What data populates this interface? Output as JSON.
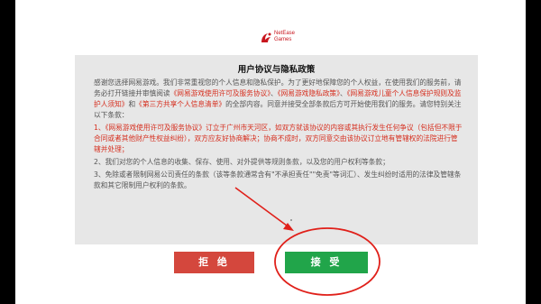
{
  "brand": {
    "logo_line1": "NetEase",
    "logo_line2": "Games"
  },
  "dialog": {
    "title": "用户协议与隐私政策",
    "intro_a": "感谢您选择网易游戏。我们非常重视您的个人信息和隐私保护。为了更好地保障您的个人权益，在使用我们的服务前，请务必打开链接并审慎阅读",
    "link1": "《网易游戏使用许可及服务协议》",
    "sep1": "、",
    "link2": "《网易游戏隐私政策》",
    "sep2": "、",
    "link3": "《网易游戏儿童个人信息保护规则及监护人须知》",
    "sep3": "和",
    "link4": "《第三方共享个人信息清单》",
    "intro_b": "的全部内容。同意并接受全部条款后方可开始使用我们的服务。请您特别关注以下条款：",
    "item1": "1、《网易游戏使用许可及服务协议》订立于广州市天河区，如双方就该协议的内容或其执行发生任何争议（包括但不限于合同或者其他财产性权益纠纷），双方应友好协商解决；协商不成时，双方同意交由该协议订立地有管辖权的法院进行管辖并处理；",
    "item2": "2、我们对您的个人信息的收集、保存、使用、对外提供等规则条款，以及您的用户权利等条款；",
    "item3": "3、免除或者限制网易公司责任的条款（该等条款通常含有\"不承担责任\"\"免责\"等词汇）、发生纠纷时适用的法律及管辖条款和其它限制用户权利的条款。"
  },
  "buttons": {
    "reject_label": "拒 绝",
    "accept_label": "接 受"
  },
  "colors": {
    "reject": "#d4473d",
    "accept": "#21a54a",
    "link": "#d62e1e",
    "annotation": "#e0201a"
  }
}
